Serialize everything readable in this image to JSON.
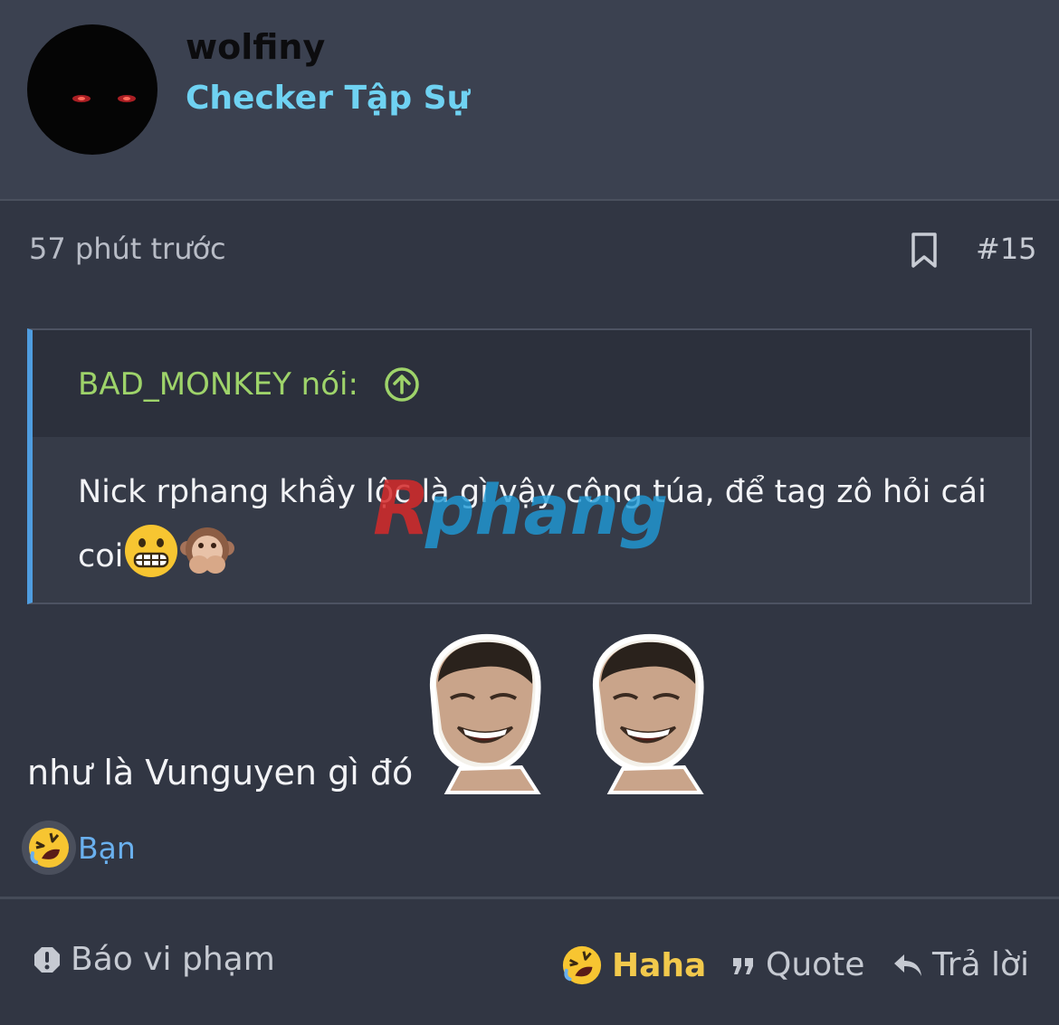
{
  "user": {
    "name": "wolfiny",
    "title": "Checker Tập Sự"
  },
  "post": {
    "time": "57 phút trước",
    "number": "#15"
  },
  "quote": {
    "author": "BAD_MONKEY nói:",
    "text": "Nick rphang khầy lộc là gì vậy công túa, để tag zô hỏi cái coi"
  },
  "watermark": "Rphang",
  "message": {
    "text": "như là Vunguyen gì đó"
  },
  "reactions": {
    "users": "Bạn"
  },
  "footer": {
    "report": "Báo vi phạm",
    "haha": "Haha",
    "quote": "Quote",
    "reply": "Trả lời"
  },
  "colors": {
    "background": "#313643",
    "header": "#3b4150",
    "user_title": "#6fd2f2",
    "quote_author": "#9ed36a",
    "quote_border": "#4f9de0",
    "link": "#6ab0ee",
    "haha": "#f2c94c"
  }
}
